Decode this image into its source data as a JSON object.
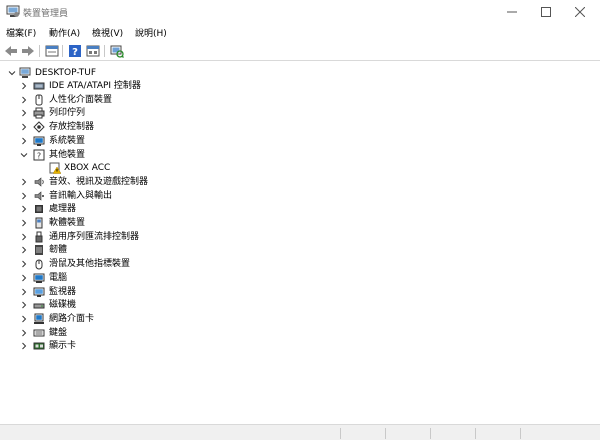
{
  "window": {
    "title": "裝置管理員"
  },
  "menu": [
    "檔案(F)",
    "動作(A)",
    "檢視(V)",
    "說明(H)"
  ],
  "toolbar": {
    "buttons": [
      "back-arrow-icon",
      "forward-arrow-icon",
      "properties-icon",
      "help-icon",
      "view-icon",
      "scan-hardware-icon"
    ]
  },
  "tree": {
    "root": "DESKTOP-TUF",
    "items": [
      {
        "label": "IDE ATA/ATAPI 控制器",
        "icon": "ide-controller-icon",
        "expanded": false
      },
      {
        "label": "人性化介面裝置",
        "icon": "hid-icon",
        "expanded": false
      },
      {
        "label": "列印佇列",
        "icon": "print-queue-icon",
        "expanded": false
      },
      {
        "label": "存放控制器",
        "icon": "storage-controller-icon",
        "expanded": false
      },
      {
        "label": "系統裝置",
        "icon": "system-devices-icon",
        "expanded": false
      },
      {
        "label": "其他裝置",
        "icon": "other-devices-icon",
        "expanded": true
      },
      {
        "label": "XBOX ACC",
        "icon": "unknown-device-warning-icon",
        "child": true
      },
      {
        "label": "音效、視訊及遊戲控制器",
        "icon": "sound-icon",
        "expanded": false
      },
      {
        "label": "音訊輸入與輸出",
        "icon": "audio-io-icon",
        "expanded": false
      },
      {
        "label": "處理器",
        "icon": "processor-icon",
        "expanded": false
      },
      {
        "label": "軟體裝置",
        "icon": "software-device-icon",
        "expanded": false
      },
      {
        "label": "通用序列匯流排控制器",
        "icon": "usb-controller-icon",
        "expanded": false
      },
      {
        "label": "韌體",
        "icon": "firmware-icon",
        "expanded": false
      },
      {
        "label": "滑鼠及其他指標裝置",
        "icon": "mouse-icon",
        "expanded": false
      },
      {
        "label": "電腦",
        "icon": "computer-icon",
        "expanded": false
      },
      {
        "label": "監視器",
        "icon": "monitor-icon",
        "expanded": false
      },
      {
        "label": "磁碟機",
        "icon": "disk-drive-icon",
        "expanded": false
      },
      {
        "label": "網路介面卡",
        "icon": "network-adapter-icon",
        "expanded": false
      },
      {
        "label": "鍵盤",
        "icon": "keyboard-icon",
        "expanded": false
      },
      {
        "label": "顯示卡",
        "icon": "display-adapter-icon",
        "expanded": false
      }
    ]
  },
  "colors": {
    "blue": "#1e78c8",
    "dark": "#444444",
    "warning": "#e8b400"
  }
}
